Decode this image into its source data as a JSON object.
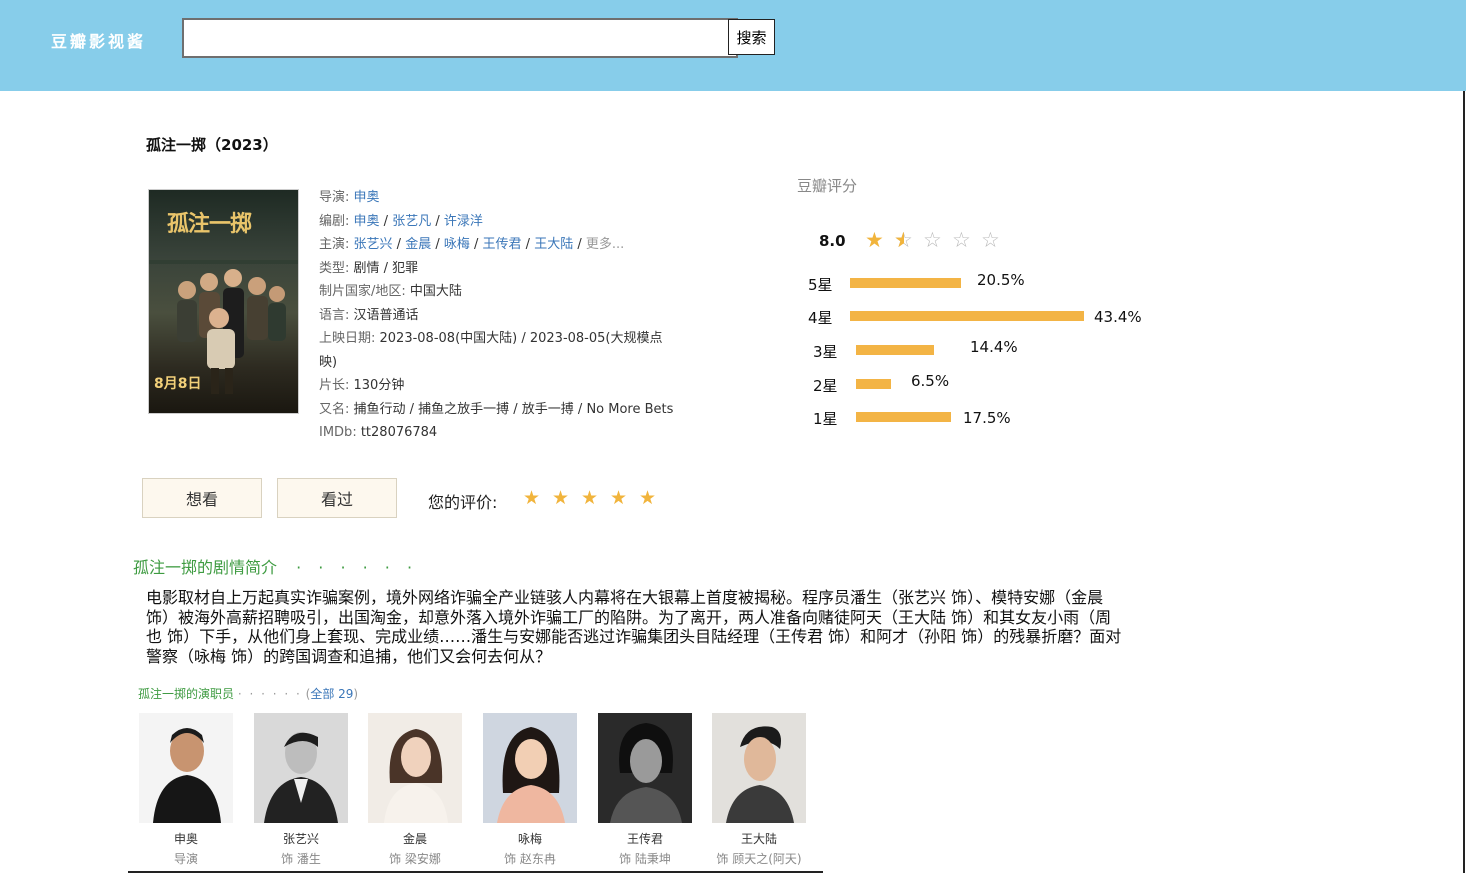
{
  "header": {
    "logo": "豆瓣影视酱",
    "search_placeholder": "",
    "search_value": "",
    "search_button": "搜索"
  },
  "movie": {
    "title": "孤注一掷（2023）",
    "poster": {
      "title_text": "孤注一掷",
      "date_text": "8月8日"
    },
    "info": {
      "director_label": "导演: ",
      "director": "申奥",
      "writers_label": "编剧: ",
      "writers": [
        "申奥",
        "张艺凡",
        "许渌洋"
      ],
      "cast_label": "主演: ",
      "cast": [
        "张艺兴",
        "金晨",
        "咏梅",
        "王传君",
        "王大陆"
      ],
      "cast_more": "更多...",
      "genre_label": "类型: ",
      "genre": "剧情 / 犯罪",
      "country_label": "制片国家/地区: ",
      "country": "中国大陆",
      "language_label": "语言: ",
      "language": "汉语普通话",
      "release_label": "上映日期: ",
      "release": "2023-08-08(中国大陆) / 2023-08-05(大规模点映)",
      "runtime_label": "片长: ",
      "runtime": "130分钟",
      "aka_label": "又名: ",
      "aka": "捕鱼行动 / 捕鱼之放手一搏 / 放手一搏 / No More Bets",
      "imdb_label": "IMDb: ",
      "imdb": "tt28076784"
    }
  },
  "rating": {
    "title": "豆瓣评分",
    "score": "8.0",
    "stars_value": 1.5,
    "stars_max": 5,
    "colors": {
      "star_full": "#f1b43c",
      "star_empty": "#bbbbbb",
      "bar": "#f3b445"
    },
    "distribution": [
      {
        "label": "5星",
        "percent": "20.5%",
        "value": 20.5
      },
      {
        "label": "4星",
        "percent": "43.4%",
        "value": 43.4
      },
      {
        "label": "3星",
        "percent": "14.4%",
        "value": 14.4
      },
      {
        "label": "2星",
        "percent": "6.5%",
        "value": 6.5
      },
      {
        "label": "1星",
        "percent": "17.5%",
        "value": 17.5
      }
    ]
  },
  "actions": {
    "want": "想看",
    "watched": "看过",
    "your_rating_label": "您的评价:",
    "your_stars": 5
  },
  "summary": {
    "heading": "孤注一掷的剧情简介",
    "dots": "· · · · · ·",
    "text": "电影取材自上万起真实诈骗案例，境外网络诈骗全产业链骇人内幕将在大银幕上首度被揭秘。程序员潘生（张艺兴 饰）、模特安娜（金晨 饰）被海外高薪招聘吸引，出国淘金，却意外落入境外诈骗工厂的陷阱。为了离开，两人准备向赌徒阿天（王大陆 饰）和其女友小雨（周也 饰）下手，从他们身上套现、完成业绩……潘生与安娜能否逃过诈骗集团头目陆经理（王传君 饰）和阿才（孙阳 饰）的残暴折磨？面对警察（咏梅 饰）的跨国调查和追捕，他们又会何去何从？"
  },
  "cast_section": {
    "heading": "孤注一掷的演职员",
    "dots": "· · · · · ·",
    "count_open": "(",
    "count": "全部 29",
    "count_close": ")",
    "members": [
      {
        "name": "申奥",
        "role": "导演"
      },
      {
        "name": "张艺兴",
        "role": "饰 潘生"
      },
      {
        "name": "金晨",
        "role": "饰 梁安娜"
      },
      {
        "name": "咏梅",
        "role": "饰 赵东冉"
      },
      {
        "name": "王传君",
        "role": "饰 陆秉坤"
      },
      {
        "name": "王大陆",
        "role": "饰 顾天之(阿天)"
      }
    ]
  }
}
